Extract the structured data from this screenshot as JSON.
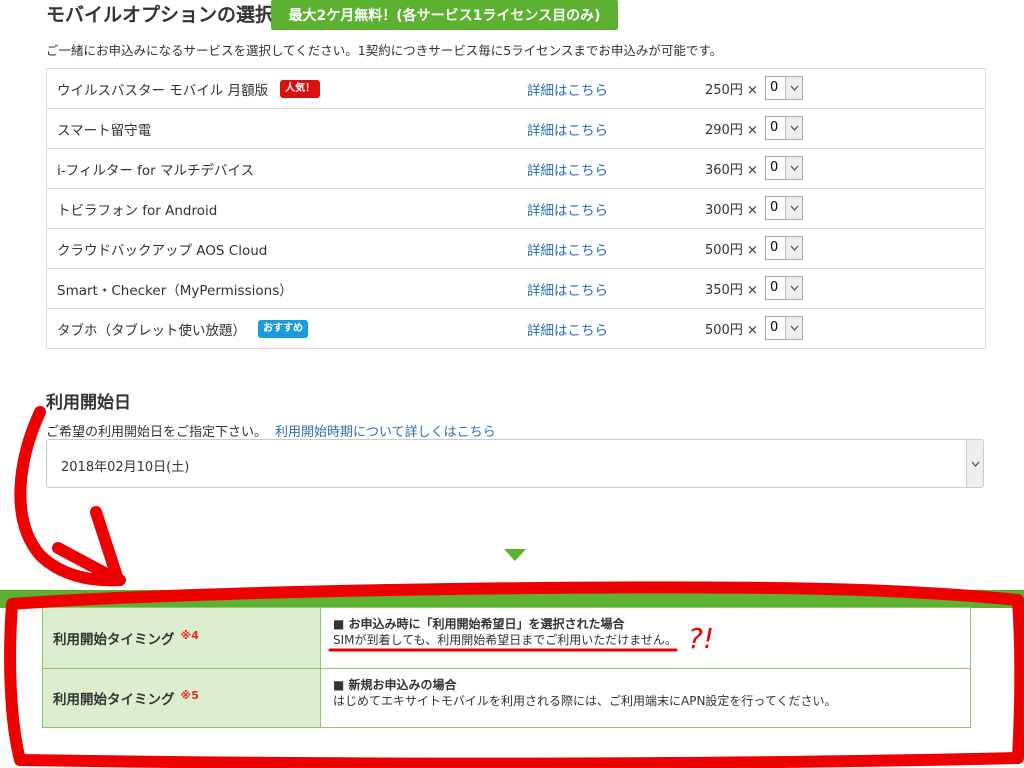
{
  "options": {
    "title": "モバイルオプションの選択",
    "free_badge": "最大2ケ月無料！(各サービス1ライセンス目のみ)",
    "description": "ご一緒にお申込みになるサービスを選択してください。1契約につきサービス毎に5ライセンスまでお申込みが可能です。",
    "items": [
      {
        "name": "ウイルスバスター モバイル 月額版",
        "tag": "人気！",
        "tag_color": "#d9120f",
        "link": "詳細はこちら",
        "price": "250円 ×",
        "qty": "0"
      },
      {
        "name": "スマート留守電",
        "tag": "",
        "link": "詳細はこちら",
        "price": "290円 ×",
        "qty": "0"
      },
      {
        "name": "i-フィルター for マルチデバイス",
        "tag": "",
        "link": "詳細はこちら",
        "price": "360円 ×",
        "qty": "0"
      },
      {
        "name": "トビラフォン for Android",
        "tag": "",
        "link": "詳細はこちら",
        "price": "300円 ×",
        "qty": "0"
      },
      {
        "name": "クラウドバックアップ AOS Cloud",
        "tag": "",
        "link": "詳細はこちら",
        "price": "500円 ×",
        "qty": "0"
      },
      {
        "name": "Smart・Checker（MyPermissions）",
        "tag": "",
        "link": "詳細はこちら",
        "price": "350円 ×",
        "qty": "0"
      },
      {
        "name": "タブホ（タブレット使い放題）",
        "tag": "おすすめ",
        "tag_color": "#1a9bdc",
        "link": "詳細はこちら",
        "price": "500円 ×",
        "qty": "0"
      }
    ]
  },
  "start_date": {
    "title": "利用開始日",
    "description": "ご希望の利用開始日をご指定下さい。",
    "link": "利用開始時期について詳しくはこちら",
    "selected": "2018年02月10日(土)"
  },
  "timing": {
    "rows": [
      {
        "label": "利用開始タイミング",
        "note": "※4",
        "heading": "■ お申込み時に「利用開始希望日」を選択された場合",
        "text": "SIMが到着しても、利用開始希望日までご利用いただけません。"
      },
      {
        "label": "利用開始タイミング",
        "note": "※5",
        "heading": "■ 新規お申込みの場合",
        "text": "はじめてエキサイトモバイルを利用される際には、ご利用端末にAPN設定を行ってください。"
      }
    ]
  },
  "annotation": {
    "text": "?!",
    "color": "#ee0000"
  },
  "colors": {
    "accent_green": "#5cb130",
    "link_blue": "#2a6fb5",
    "note_red": "#e8261a"
  }
}
